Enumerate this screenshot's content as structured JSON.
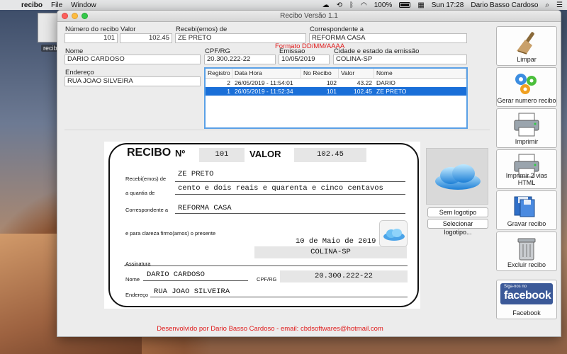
{
  "menubar": {
    "app": "recibo",
    "items": [
      "File",
      "Window"
    ],
    "battery_pct": "100%",
    "clock": "Sun 17:28",
    "user": "Dario Basso Cardoso"
  },
  "desktop": {
    "icon_label": "recibo"
  },
  "window": {
    "title": "Recibo Versão 1.1"
  },
  "form": {
    "numero_label": "Número do recibo",
    "numero_value": "101",
    "valor_label": "Valor",
    "valor_value": "102.45",
    "recebi_label": "Recebi(emos) de",
    "recebi_value": "ZE PRETO",
    "correspondente_label": "Correspondente a",
    "correspondente_value": "REFORMA CASA",
    "nome_label": "Nome",
    "nome_value": "DARIO CARDOSO",
    "cpf_label": "CPF/RG",
    "cpf_value": "20.300.222-22",
    "formato_hint": "Formato DD/MM/AAAA",
    "emissao_label": "Emissao",
    "emissao_value": "10/05/2019",
    "cidade_label": "Cidade e estado da emissão",
    "cidade_value": "COLINA-SP",
    "endereco_label": "Endereço",
    "endereco_value": "RUA JOAO SILVEIRA"
  },
  "table": {
    "headers": [
      "Registro",
      "Data Hora",
      "No Recibo",
      "Valor",
      "Nome"
    ],
    "rows": [
      [
        "2",
        "26/05/2019 - 11:54:01",
        "102",
        "43.22",
        "DARIO"
      ],
      [
        "1",
        "26/05/2019 - 11:52:34",
        "101",
        "102.45",
        "ZE PRETO"
      ]
    ],
    "selected_row": 1
  },
  "receipt": {
    "title": "RECIBO",
    "numero_sign": "Nº",
    "numero": "101",
    "valor_label": "VALOR",
    "valor": "102.45",
    "recebi_label": "Recebi(emos) de",
    "recebi_value": "ZE PRETO",
    "quantia_label": "a quantia de",
    "quantia_value": "cento e dois reais e quarenta e cinco centavos",
    "correspondente_label": "Correspondente a",
    "correspondente_value": "REFORMA CASA",
    "clareza_label": "e para clareza firmo(amos) o presente",
    "data_extenso": "10 de Maio de 2019",
    "cidade": "COLINA-SP",
    "assinatura_label": "Assinatura",
    "nome_label": "Nome",
    "nome_value": "DARIO CARDOSO",
    "cpf_label": "CPF/RG",
    "cpf_value": "20.300.222-22",
    "endereco_label": "Endereço",
    "endereco_value": "RUA JOAO SILVEIRA"
  },
  "logo": {
    "sem_logotipo": "Sem logotipo",
    "selecionar_logotipo": "Selecionar logotipo..."
  },
  "toolbar": {
    "limpar": "Limpar",
    "gerar": "Gerar numero recibo",
    "imprimir": "Imprimir",
    "imprimir2": "Imprimir 2 vias HTML",
    "gravar": "Gravar recibo",
    "excluir": "Excluir recibo",
    "facebook": "Facebook",
    "fb_small": "Siga-nos no",
    "fb_big": "facebook"
  },
  "footer": "Desenvolvido por Dario Basso Cardoso - email: cbdsoftwares@hotmail.com",
  "colors": {
    "selection": "#1a6fd8",
    "accent_red": "#e01b1b",
    "facebook": "#3b5998"
  }
}
